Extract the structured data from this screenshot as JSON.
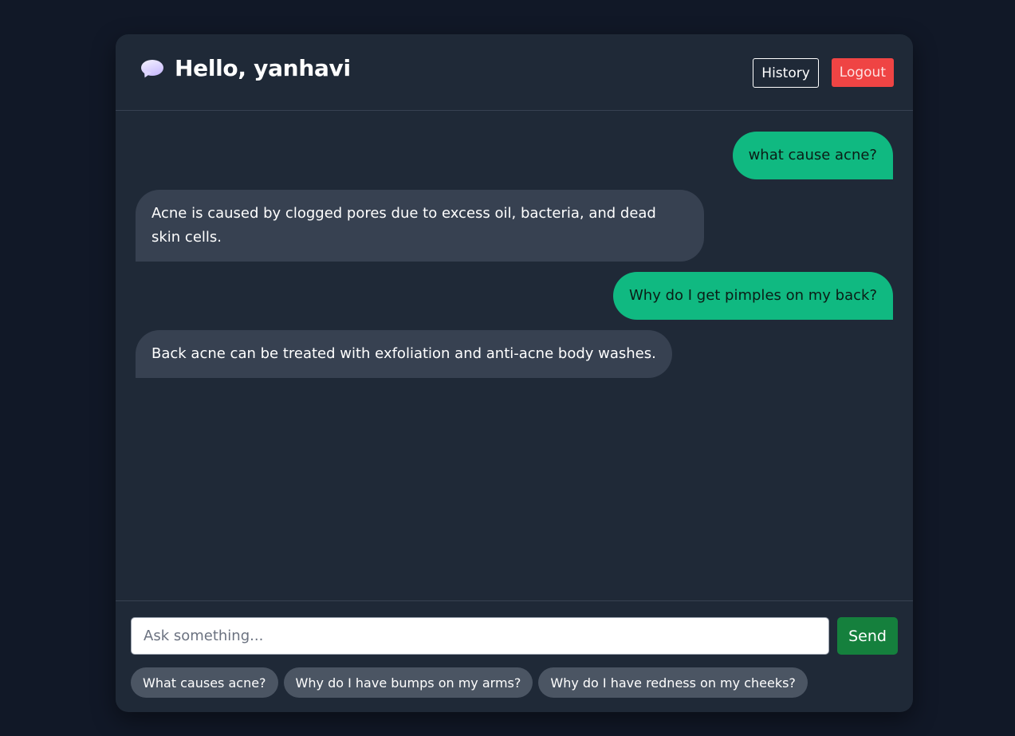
{
  "header": {
    "icon": "speech-balloon-icon",
    "title": "Hello, yanhavi",
    "history_label": "History",
    "logout_label": "Logout"
  },
  "messages": [
    {
      "role": "user",
      "text": "what cause acne?"
    },
    {
      "role": "bot",
      "text": "Acne is caused by clogged pores due to excess oil, bacteria, and dead skin cells."
    },
    {
      "role": "user",
      "text": "Why do I get pimples on my back?"
    },
    {
      "role": "bot",
      "text": "Back acne can be treated with exfoliation and anti-acne body washes."
    }
  ],
  "composer": {
    "input_value": "",
    "placeholder": "Ask something...",
    "send_label": "Send"
  },
  "suggestions": [
    "What causes acne?",
    "Why do I have bumps on my arms?",
    "Why do I have redness on my cheeks?"
  ],
  "colors": {
    "page_bg": "#111827",
    "panel_bg": "#1f2937",
    "user_bubble": "#10b981",
    "bot_bubble": "#374151",
    "logout": "#ef4444",
    "send": "#15803d",
    "chip": "#4b5563"
  }
}
